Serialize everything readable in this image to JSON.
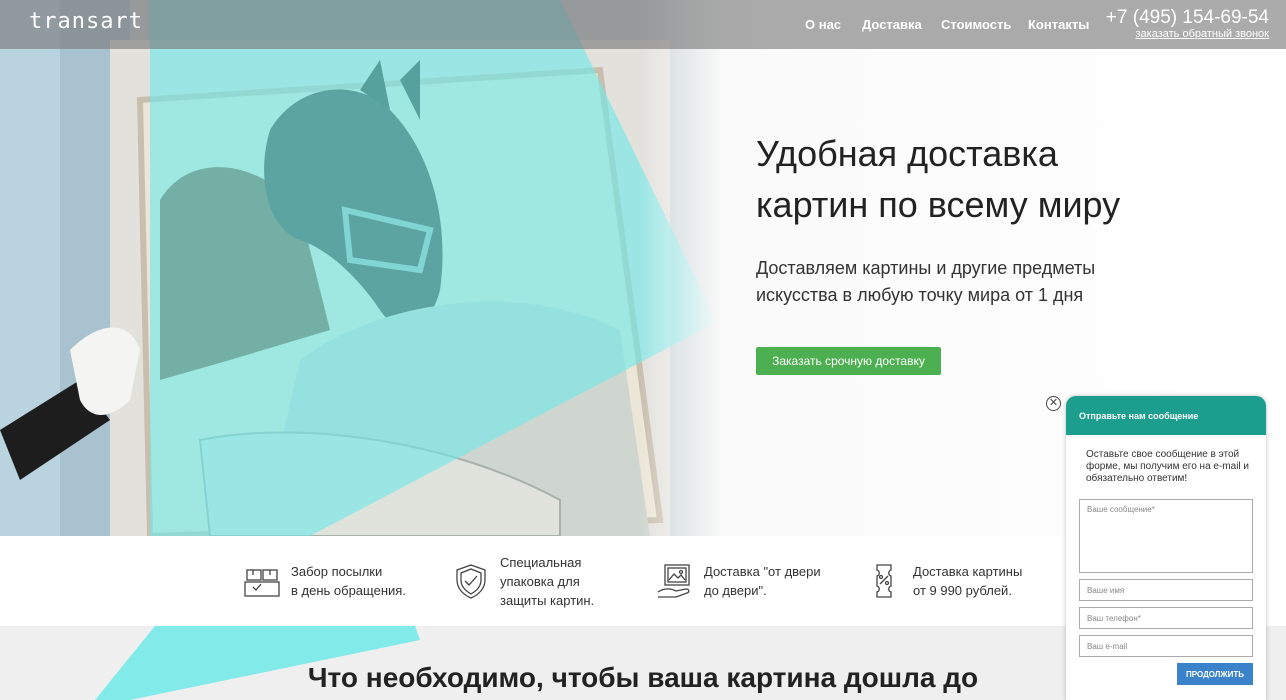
{
  "header": {
    "logo": "transart",
    "nav": [
      "О нас",
      "Доставка",
      "Стоимость",
      "Контакты"
    ],
    "phone": "+7 (495) 154-69-54",
    "callback": "заказать обратный звонок"
  },
  "hero": {
    "title": "Удобная доставка картин по всему миру",
    "subtitle": "Доставляем картины и другие предметы искусства в любую точку мира от 1 дня",
    "cta": "Заказать срочную доставку"
  },
  "features": [
    {
      "icon": "boxes-icon",
      "text": "Забор посылки\nв день обращения."
    },
    {
      "icon": "shield-check-icon",
      "text": "Специальная\nупаковка для\nзащиты картин."
    },
    {
      "icon": "picture-hand-icon",
      "text": "Доставка \"от двери\nдо двери\"."
    },
    {
      "icon": "discount-ticket-icon",
      "text": "Доставка картины\nот 9 990 рублей."
    }
  ],
  "section": {
    "title": "Что необходимо, чтобы ваша картина дошла до"
  },
  "chat": {
    "close": "✕",
    "header": "Отправьте нам сообщение",
    "intro": "Оставьте свое сообщение в этой форме, мы получим его на e-mail и обязательно ответим!",
    "message_placeholder": "Ваше сообщение*",
    "name_placeholder": "Ваше имя",
    "phone_placeholder": "Ваш телефон*",
    "email_placeholder": "Ваш e-mail",
    "submit": "ПРОДОЛЖИТЬ"
  },
  "colors": {
    "accent_cyan": "#6fe9e8",
    "cta_green": "#4caf50",
    "chat_header": "#1b9e8e",
    "chat_button": "#3a82c9"
  }
}
